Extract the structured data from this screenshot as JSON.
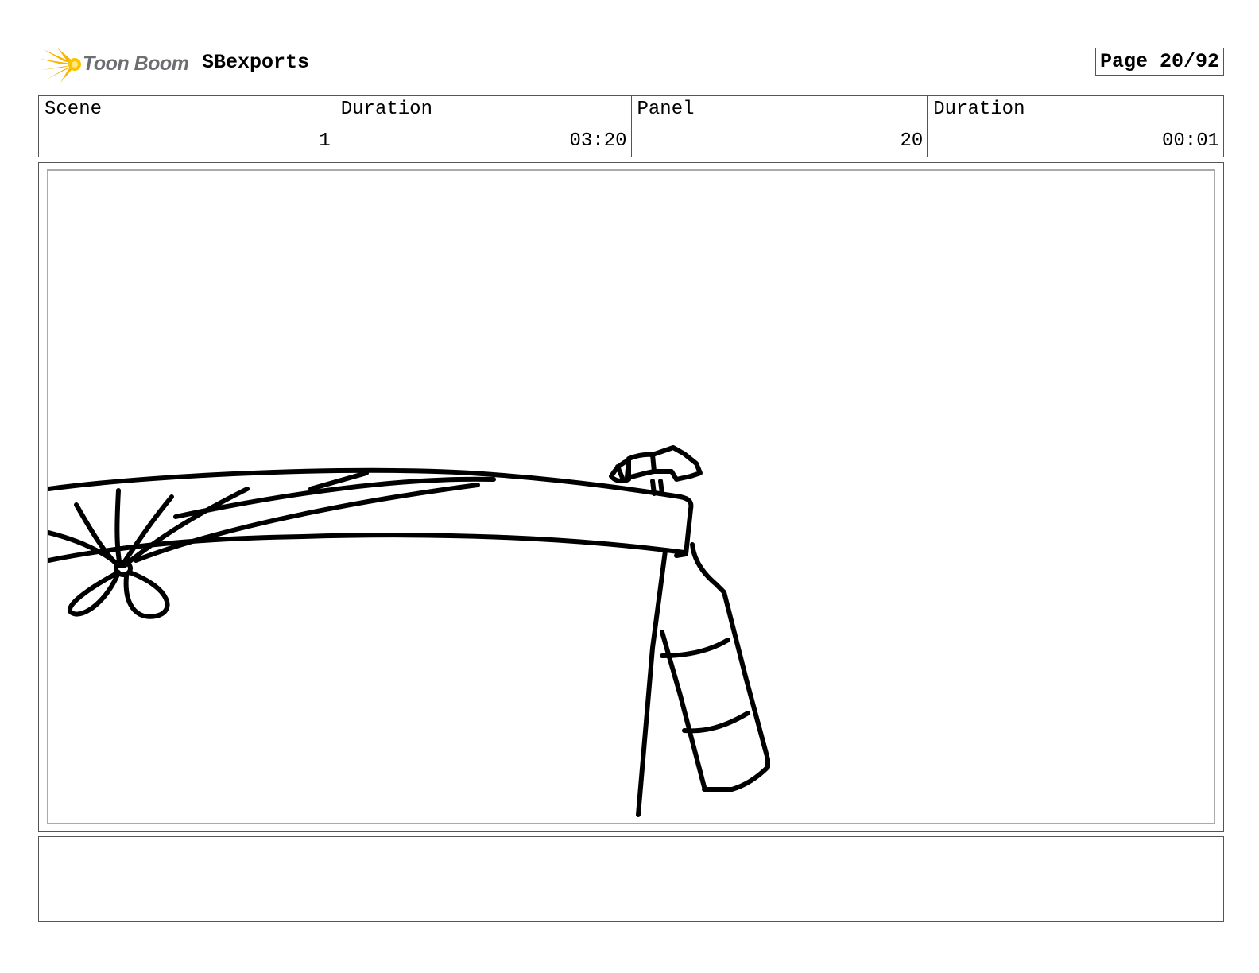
{
  "header": {
    "logo_text": "Toon Boom",
    "project_name": "SBexports",
    "page_label": "Page 20/92"
  },
  "info": [
    {
      "label": "Scene",
      "value": "1"
    },
    {
      "label": "Duration",
      "value": "03:20"
    },
    {
      "label": "Panel",
      "value": "20"
    },
    {
      "label": "Duration",
      "value": "00:01"
    }
  ],
  "notes": {
    "text": ""
  },
  "colors": {
    "logo_star": "#f7b500",
    "logo_text": "#6d6e71",
    "border": "#555555"
  }
}
